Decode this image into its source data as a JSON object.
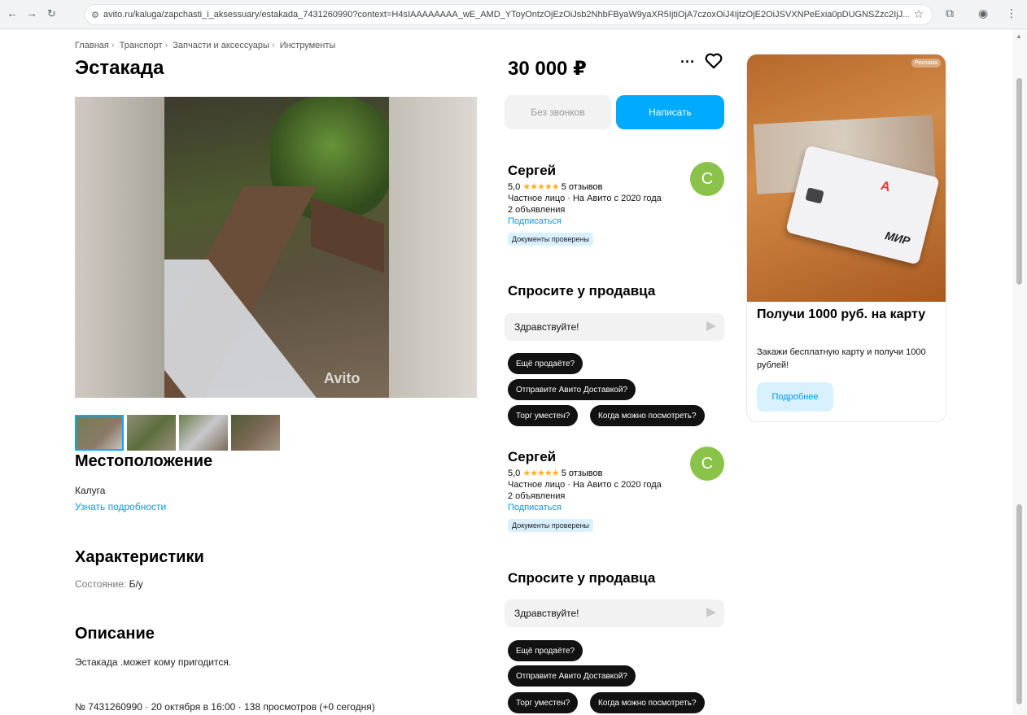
{
  "browser": {
    "url": "avito.ru/kaluga/zapchasti_i_aksessuary/estakada_7431260990?context=H4sIAAAAAAAA_wE_AMD_YToyOntzOjEzOiJsb2NhbFByaW9yaXR5IjtiOjA7czoxOiJ4IjtzOjE2OiJSVXNPeExia0pDUGNSZzc2IjJ..."
  },
  "breadcrumbs": [
    "Главная",
    "Транспорт",
    "Запчасти и аксессуары",
    "Инструменты"
  ],
  "title": "Эстакада",
  "gallery": {
    "watermark": "Avito",
    "thumbnail_count": 4,
    "active_thumbnail": 1
  },
  "location": {
    "heading": "Местоположение",
    "city": "Калуга",
    "link": "Узнать подробности"
  },
  "characteristics": {
    "heading": "Характеристики",
    "label": "Состояние:",
    "value": "Б/у"
  },
  "description": {
    "heading": "Описание",
    "text": "Эстакада .может кому пригодится."
  },
  "meta": "№ 7431260990 · 20 октября в 16:00 · 138 просмотров (+0 сегодня)",
  "price": "30 000 ₽",
  "actions": {
    "no_calls": "Без звонков",
    "write": "Написать"
  },
  "seller": {
    "name": "Сергей",
    "rating": "5,0",
    "stars": "★★★★★",
    "reviews": "5 отзывов",
    "type": "Частное лицо · На Авито с 2020 года",
    "ads": "2 объявления",
    "subscribe": "Подписаться",
    "badge": "Документы проверены",
    "avatar_letter": "С"
  },
  "ask": {
    "heading": "Спросите у продавца",
    "input_value": "Здравствуйте!",
    "chips": [
      "Ещё продаёте?",
      "Отправите Авито Доставкой?",
      "Торг уместен?",
      "Когда можно посмотреть?"
    ]
  },
  "ad": {
    "badge": "Реклама",
    "card_brand": "А",
    "card_mir": "МИР",
    "title": "Получи 1000 руб. на карту",
    "text": "Закажи бесплатную карту и получи 1000 рублей!",
    "button": "Подробнее"
  },
  "colors": {
    "accent": "#00aaff",
    "link": "#0099f7",
    "chip": "#121212",
    "avatar": "#8bc34a",
    "star": "#ffb021"
  }
}
